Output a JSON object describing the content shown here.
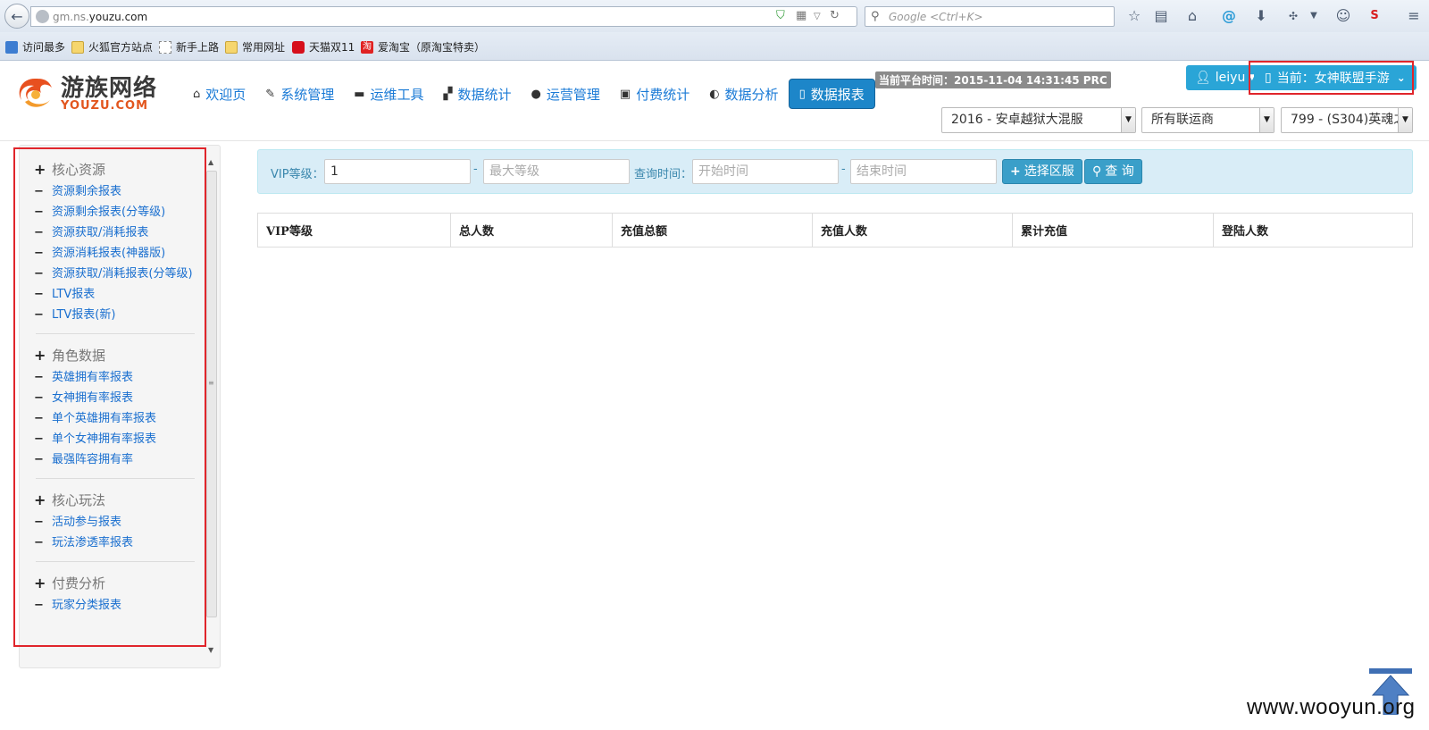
{
  "browser": {
    "url_prefix": "gm.ns.",
    "url_domain": "youzu.com",
    "search_placeholder": "Google <Ctrl+K>",
    "bookmarks": [
      {
        "label": "访问最多"
      },
      {
        "label": "火狐官方站点"
      },
      {
        "label": "新手上路"
      },
      {
        "label": "常用网址"
      },
      {
        "label": "天猫双11"
      },
      {
        "label": "爱淘宝（原淘宝特卖）"
      }
    ]
  },
  "header": {
    "logo_cn": "游族网络",
    "logo_en": "YOUZU.COM",
    "nav": [
      {
        "label": "欢迎页",
        "icon": "home-icon"
      },
      {
        "label": "系统管理",
        "icon": "wrench-icon"
      },
      {
        "label": "运维工具",
        "icon": "hdd-icon"
      },
      {
        "label": "数据统计",
        "icon": "signal-icon"
      },
      {
        "label": "运营管理",
        "icon": "globe-icon"
      },
      {
        "label": "付费统计",
        "icon": "gift-icon"
      },
      {
        "label": "数据分析",
        "icon": "adjust-icon"
      },
      {
        "label": "数据报表",
        "icon": "book-icon",
        "active": true
      }
    ],
    "server_time": "当前平台时间：2015-11-04 14:31:45 PRC",
    "user": "leiyu",
    "current_game": "当前：女神联盟手游",
    "selects": {
      "server": "2016 - 安卓越狱大混服",
      "operator": "所有联运商",
      "zone": "799 - (S304)英魂之"
    }
  },
  "sidebar": {
    "groups": [
      {
        "title": "核心资源",
        "items": [
          "资源剩余报表",
          "资源剩余报表(分等级)",
          "资源获取/消耗报表",
          "资源消耗报表(神器版)",
          "资源获取/消耗报表(分等级)",
          "LTV报表",
          "LTV报表(新)"
        ]
      },
      {
        "title": "角色数据",
        "items": [
          "英雄拥有率报表",
          "女神拥有率报表",
          "单个英雄拥有率报表",
          "单个女神拥有率报表",
          "最强阵容拥有率"
        ]
      },
      {
        "title": "核心玩法",
        "items": [
          "活动参与报表",
          "玩法渗透率报表"
        ]
      },
      {
        "title": "付费分析",
        "items": [
          "玩家分类报表"
        ]
      }
    ]
  },
  "filter": {
    "vip_label": "VIP等级：",
    "vip_min_value": "1",
    "vip_max_placeholder": "最大等级",
    "dash": "-",
    "time_label": "查询时间：",
    "start_placeholder": "开始时间",
    "end_placeholder": "结束时间",
    "select_server_btn": "选择区服",
    "query_btn": "查 询"
  },
  "table": {
    "columns": [
      "VIP等级",
      "总人数",
      "充值总额",
      "充值人数",
      "累计充值",
      "登陆人数"
    ]
  },
  "watermark": "www.wooyun.org"
}
